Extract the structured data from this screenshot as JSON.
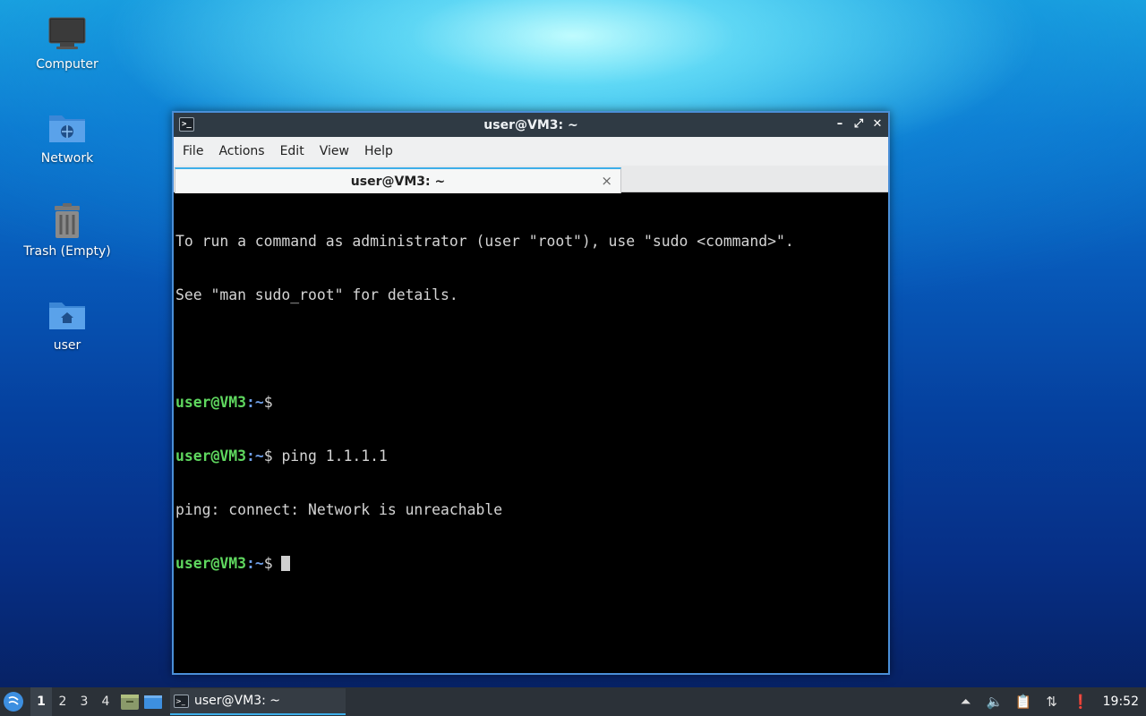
{
  "desktop": {
    "icons": [
      {
        "label": "Computer",
        "icon": "computer-icon"
      },
      {
        "label": "Network",
        "icon": "network-folder-icon"
      },
      {
        "label": "Trash (Empty)",
        "icon": "trash-icon"
      },
      {
        "label": "user",
        "icon": "home-folder-icon"
      }
    ]
  },
  "window": {
    "title": "user@VM3: ~",
    "controls": {
      "minimize": "–",
      "maximize": "⤢",
      "close": "✕"
    },
    "menu": [
      "File",
      "Actions",
      "Edit",
      "View",
      "Help"
    ],
    "tab": {
      "label": "user@VM3: ~",
      "close": "×"
    },
    "terminal": {
      "lines": [
        {
          "text": "To run a command as administrator (user \"root\"), use \"sudo <command>\"."
        },
        {
          "text": "See \"man sudo_root\" for details."
        },
        {
          "text": ""
        },
        {
          "user": "user@VM3",
          "path": ":~",
          "suffix": "$"
        },
        {
          "user": "user@VM3",
          "path": ":~",
          "suffix": "$ ping 1.1.1.1"
        },
        {
          "text": "ping: connect: Network is unreachable"
        },
        {
          "user": "user@VM3",
          "path": ":~",
          "suffix": "$ "
        }
      ]
    }
  },
  "taskbar": {
    "workspaces": [
      "1",
      "2",
      "3",
      "4"
    ],
    "active_workspace": "1",
    "task_label": "user@VM3: ~",
    "clock": "19:52"
  },
  "colors": {
    "accent": "#3daee9",
    "prompt_user": "#5fd75f",
    "prompt_path": "#6f9fe8",
    "titlebar": "#2f3a44",
    "taskbar": "#2b3138"
  }
}
